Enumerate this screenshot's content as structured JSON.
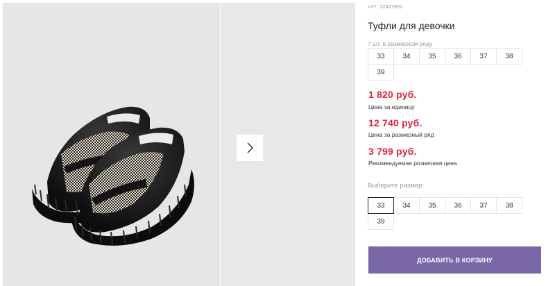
{
  "product": {
    "sku_label": "АРТ.",
    "sku": "22427901",
    "title": "Туфли для девочки"
  },
  "size_row": {
    "note": "7 шт. в размерном ряду",
    "sizes": [
      "33",
      "34",
      "35",
      "36",
      "37",
      "38",
      "39"
    ]
  },
  "prices": {
    "unit_price": "1 820 руб.",
    "unit_label": "Цена за единицу",
    "row_price": "12 740 руб.",
    "row_label": "Цена за размерный ряд",
    "retail_price": "3 799 руб.",
    "retail_label": "Рекомендуемая розничная цена"
  },
  "size_select": {
    "prompt": "Выберите размер:",
    "sizes": [
      "33",
      "34",
      "35",
      "36",
      "37",
      "38",
      "39"
    ],
    "selected": "33"
  },
  "cart": {
    "button_label": "ДОБАВИТЬ В КОРЗИНУ"
  },
  "gallery": {
    "main_image": "black-loafers-houndstooth-photo",
    "next_icon": "chevron-right-icon"
  },
  "colors": {
    "price_red": "#e0233a",
    "button_purple": "#7966a6"
  }
}
